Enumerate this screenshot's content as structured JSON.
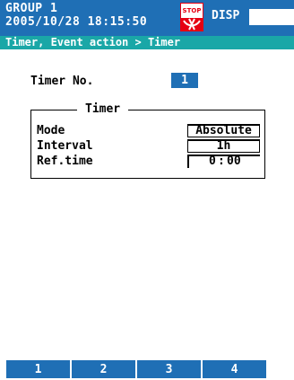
{
  "header": {
    "group": "GROUP 1",
    "datetime": "2005/10/28 18:15:50",
    "mode": "DISP",
    "stop_icon": "stop-recording-icon"
  },
  "breadcrumb": "Timer, Event action > Timer",
  "timer_no": {
    "label": "Timer No.",
    "value": "1"
  },
  "timer_group": {
    "title": "Timer",
    "mode": {
      "label": "Mode",
      "value": "Absolute"
    },
    "interval": {
      "label": "Interval",
      "value": "1h"
    },
    "ref_time": {
      "label": "Ref.time",
      "hour": "0",
      "separator": ":",
      "minute": "00"
    }
  },
  "softkeys": [
    "1",
    "2",
    "3",
    "4"
  ],
  "colors": {
    "header": "#1f6fb5",
    "breadcrumb": "#1aa7a7",
    "softkey": "#1f6fb5"
  }
}
